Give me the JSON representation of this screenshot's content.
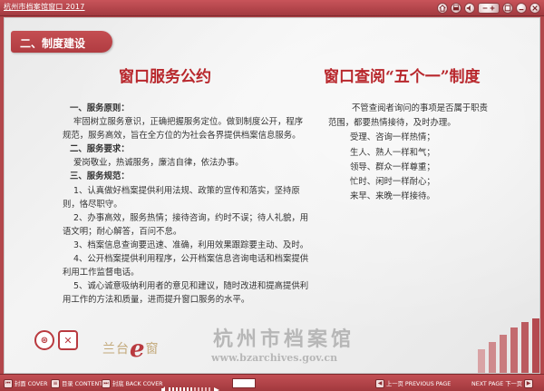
{
  "window": {
    "title": "杭州市档案馆窗口 2017"
  },
  "section": {
    "label": "二、制度建设"
  },
  "left": {
    "title": "窗口服务公约",
    "paragraphs": [
      "一、服务原则：",
      "牢固树立服务意识，正确把握服务定位。做到制度公开，程序",
      "规范，服务高效，旨在全方位的为社会各界提供档案信息服务。",
      "二、服务要求：",
      "爱岗敬业，热诚服务，廉洁自律，依法办事。",
      "三、服务规范：",
      "1、认真做好档案提供利用法规、政策的宣传和落实，坚持原",
      "则，恪尽职守。",
      "2、办事高效，服务热情；接待咨询，约时不误；待人礼貌，用",
      "语文明；耐心解答，百问不怠。",
      "3、档案信息查询要迅速、准确，利用效果跟踪要主动、及时。",
      "4、公开档案提供利用程序，公开档案信息咨询电话和档案提供",
      "利用工作监督电话。",
      "5、诚心诚意吸纳利用者的意见和建议，随时改进和提高提供利",
      "用工作的方法和质量，进而提升窗口服务的水平。"
    ]
  },
  "right": {
    "title": "窗口查阅“五个一”制度",
    "intro_1": "不管查阅者询问的事项是否属于职责",
    "intro_2": "范围，都要热情接待，及时办理。",
    "items": [
      "受理、咨询一样热情；",
      "生人、熟人一样和气；",
      "领导、群众一样尊重；",
      "忙时、闲时一样耐心；",
      "来早、来晚一样接待。"
    ]
  },
  "branding": {
    "lantai_prefix": "兰台",
    "lantai_e": "e",
    "lantai_suffix": "窗",
    "archive_name": "杭州市档案馆",
    "archive_url": "www.bzarchives.gov.cn"
  },
  "toolbar": {
    "front_cover": "封面 COVER",
    "contents": "目录 CONTENTS",
    "back_cover": "封底 BACK COVER",
    "page_number": "",
    "previous_page": "上一页 PREVIOUS PAGE",
    "next_page": "NEXT PAGE 下一页"
  },
  "colors": {
    "accent": "#b8272c",
    "frame": "#b3474b"
  }
}
